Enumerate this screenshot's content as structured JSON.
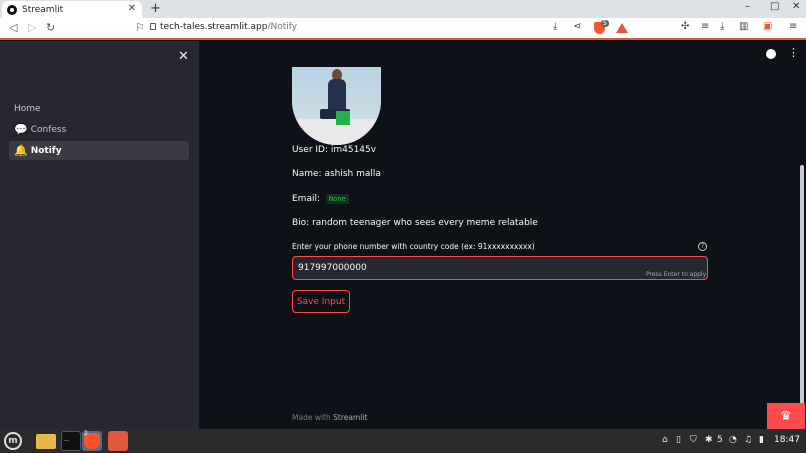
{
  "browser": {
    "tab_title": "Streamlit",
    "tab_close": "✕",
    "new_tab": "+",
    "url_host": "tech-tales.streamlit.app",
    "url_path": "/Notify",
    "shield_count": "5",
    "window_controls": {
      "minimize": "–",
      "maximize": "□",
      "close": "✕"
    }
  },
  "sidebar": {
    "close_icon": "✕",
    "items": [
      {
        "label": "Home",
        "emoji": ""
      },
      {
        "label": "Confess",
        "emoji": "💬"
      },
      {
        "label": "Notify",
        "emoji": "🔔",
        "active": true
      }
    ]
  },
  "profile": {
    "user_id": "User ID: im45145v",
    "name": "Name: ashish malla",
    "email_label": "Email:",
    "email_value": "None",
    "bio": "Bio: random teenager who sees every meme relatable"
  },
  "phone_input": {
    "label": "Enter your phone number with country code (ex: 91xxxxxxxxxx)",
    "value": "917997000000",
    "hint": "Press Enter to apply",
    "help": "?"
  },
  "save_button": {
    "label": "Save Input"
  },
  "footer": {
    "made_with": "Made with",
    "brand": "Streamlit"
  },
  "taskbar": {
    "brave_badge": "2",
    "tray_count": "5",
    "clock": "18:47"
  },
  "colors": {
    "accent": "#ff4b4b",
    "sidebar_bg": "#262730",
    "main_bg": "#0e1117"
  }
}
